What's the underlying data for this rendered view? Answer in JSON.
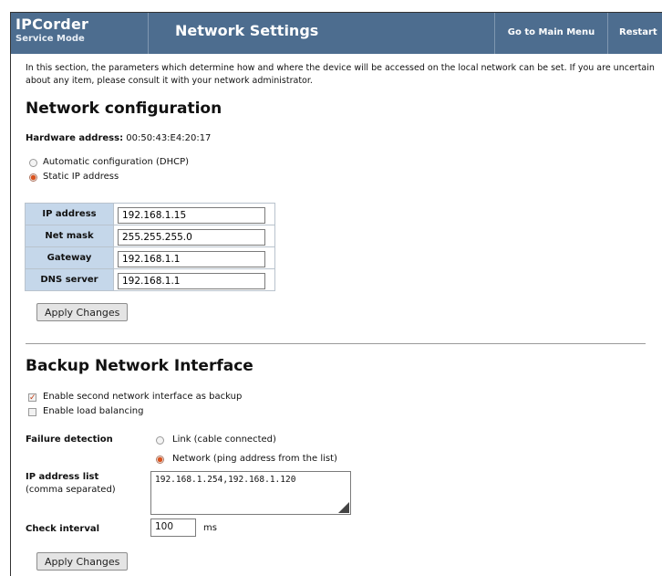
{
  "header": {
    "brand_title": "IPCorder",
    "brand_sub": "Service Mode",
    "title": "Network Settings",
    "menu_link": "Go to Main Menu",
    "restart_link": "Restart"
  },
  "intro": "In this section, the parameters which determine how and where the device will be accessed on the local network can be set. If you are uncertain about any item, please consult it with your network administrator.",
  "network": {
    "heading": "Network configuration",
    "hw_label": "Hardware address:",
    "hw_value": "00:50:43:E4:20:17",
    "mode_options": [
      {
        "label": "Automatic configuration (DHCP)",
        "selected": false
      },
      {
        "label": "Static IP address",
        "selected": true
      }
    ],
    "fields": [
      {
        "label": "IP address",
        "value": "192.168.1.15"
      },
      {
        "label": "Net mask",
        "value": "255.255.255.0"
      },
      {
        "label": "Gateway",
        "value": "192.168.1.1"
      },
      {
        "label": "DNS server",
        "value": "192.168.1.1"
      }
    ],
    "apply_label": "Apply Changes"
  },
  "backup": {
    "heading": "Backup Network Interface",
    "enable_backup": {
      "label": "Enable second network interface as backup",
      "checked": true
    },
    "enable_balancing": {
      "label": "Enable load balancing",
      "checked": false
    },
    "failure_label": "Failure detection",
    "failure_options": [
      {
        "label": "Link (cable connected)",
        "selected": false
      },
      {
        "label": "Network (ping address from the list)",
        "selected": true
      }
    ],
    "ip_list_label": "IP address list",
    "ip_list_sub": "(comma separated)",
    "ip_list_value": "192.168.1.254,192.168.1.120",
    "interval_label": "Check interval",
    "interval_value": "100",
    "interval_unit": "ms",
    "apply_label": "Apply Changes"
  },
  "colors": {
    "header_bg": "#4d6d8f",
    "label_cell_bg": "#c5d7ea",
    "radio_selected": "#d9531e"
  }
}
